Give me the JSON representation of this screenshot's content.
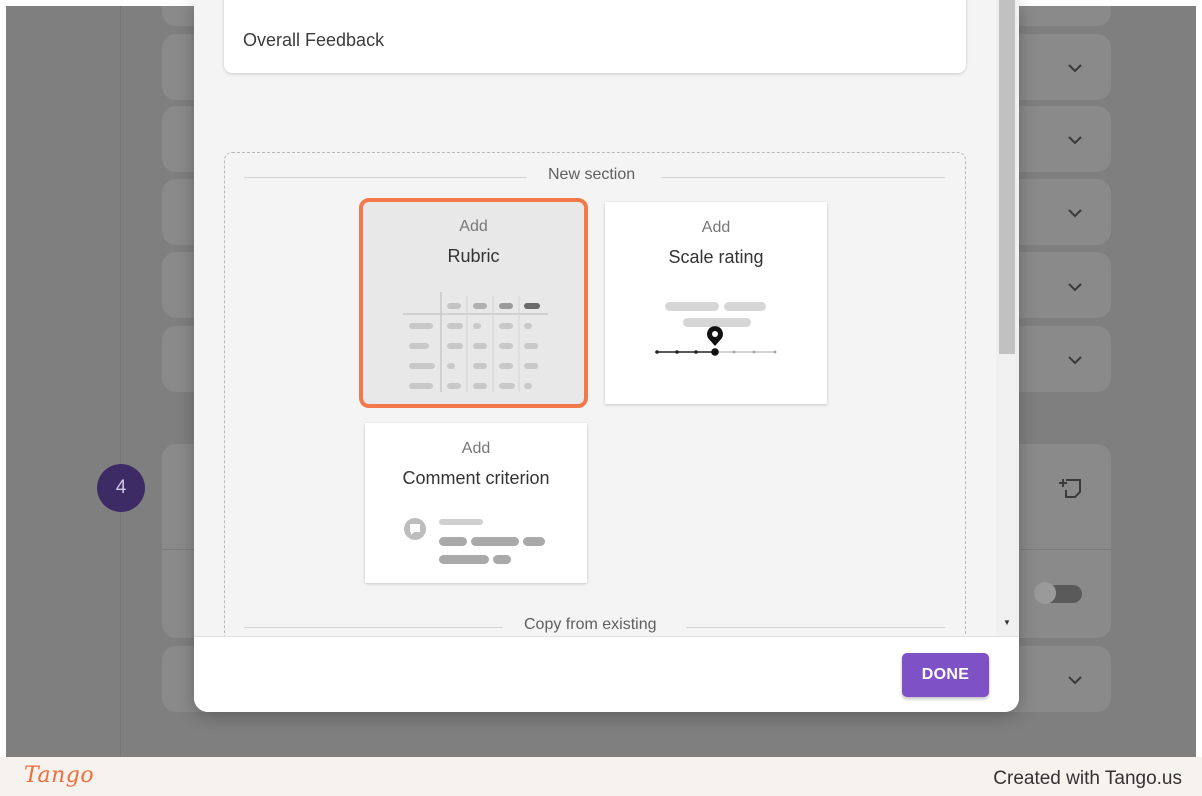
{
  "dialog": {
    "feedback_card_label": "Overall Feedback",
    "new_section_label": "New section",
    "copy_section_label": "Copy from existing",
    "tiles": [
      {
        "add_label": "Add",
        "name": "Rubric",
        "selected": true
      },
      {
        "add_label": "Add",
        "name": "Scale rating",
        "selected": false
      },
      {
        "add_label": "Add",
        "name": "Comment criterion",
        "selected": false
      }
    ],
    "done_label": "DONE"
  },
  "background": {
    "step_number": "4"
  },
  "branding": {
    "logo": "Tango",
    "credit": "Created with Tango.us"
  },
  "colors": {
    "accent_purple": "#7e51c7",
    "highlight_orange": "#f4794a",
    "brand_orange": "#f26b3a",
    "step_badge": "#3d2b66"
  }
}
